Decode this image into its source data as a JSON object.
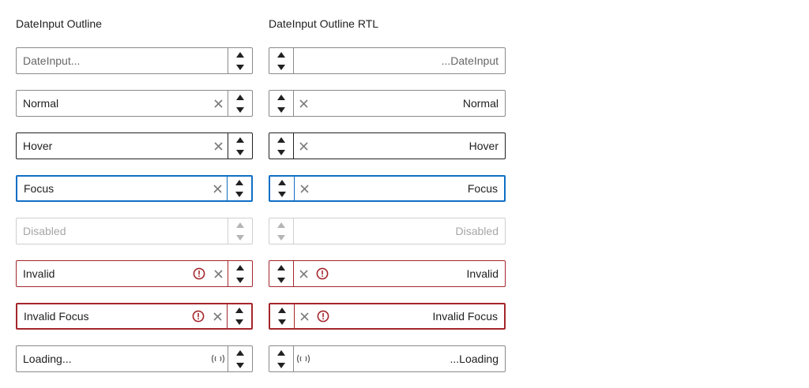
{
  "columns": [
    {
      "id": "ltr",
      "heading": "DateInput Outline",
      "fields": [
        {
          "state": "placeholder",
          "text": "DateInput...",
          "clear": false,
          "error": false,
          "loading": false
        },
        {
          "state": "normal",
          "text": "Normal",
          "clear": true,
          "error": false,
          "loading": false
        },
        {
          "state": "hover",
          "text": "Hover",
          "clear": true,
          "error": false,
          "loading": false
        },
        {
          "state": "focus",
          "text": "Focus",
          "clear": true,
          "error": false,
          "loading": false
        },
        {
          "state": "disabled",
          "text": "Disabled",
          "clear": false,
          "error": false,
          "loading": false
        },
        {
          "state": "invalid",
          "text": "Invalid",
          "clear": true,
          "error": true,
          "loading": false
        },
        {
          "state": "invalid-focus",
          "text": "Invalid Focus",
          "clear": true,
          "error": true,
          "loading": false
        },
        {
          "state": "loading",
          "text": "Loading...",
          "clear": false,
          "error": false,
          "loading": true
        }
      ]
    },
    {
      "id": "rtl",
      "heading": "DateInput Outline RTL",
      "fields": [
        {
          "state": "placeholder",
          "text": "...DateInput",
          "clear": false,
          "error": false,
          "loading": false
        },
        {
          "state": "normal",
          "text": "Normal",
          "clear": true,
          "error": false,
          "loading": false
        },
        {
          "state": "hover",
          "text": "Hover",
          "clear": true,
          "error": false,
          "loading": false
        },
        {
          "state": "focus",
          "text": "Focus",
          "clear": true,
          "error": false,
          "loading": false
        },
        {
          "state": "disabled",
          "text": "Disabled",
          "clear": false,
          "error": false,
          "loading": false
        },
        {
          "state": "invalid",
          "text": "Invalid",
          "clear": true,
          "error": true,
          "loading": false
        },
        {
          "state": "invalid-focus",
          "text": "Invalid Focus",
          "clear": true,
          "error": true,
          "loading": false
        },
        {
          "state": "loading",
          "text": "...Loading",
          "clear": false,
          "error": false,
          "loading": true
        }
      ]
    }
  ],
  "icons": {
    "clear": "x-icon",
    "error": "exclamation-circle-icon",
    "loading": "loading-spinner-icon",
    "increase": "caret-up-icon",
    "decrease": "caret-down-icon"
  },
  "colors": {
    "focus": "#0f6fc5",
    "invalid": "#a4262c",
    "border": "#8a8a8a",
    "disabled": "#cfcfcf"
  }
}
